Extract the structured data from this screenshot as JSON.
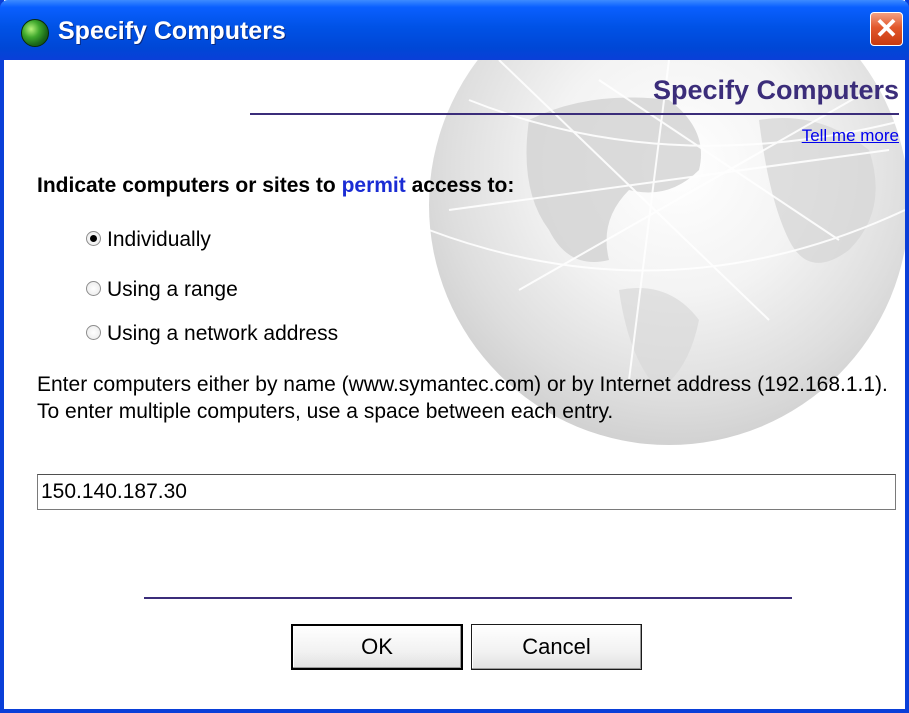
{
  "window": {
    "title": "Specify Computers",
    "icon": "globe-icon",
    "close_glyph": "✕"
  },
  "header": {
    "title": "Specify Computers",
    "help_link": "Tell me more"
  },
  "prompt": {
    "prefix": "Indicate computers or sites to ",
    "emphasis": "permit",
    "suffix": " access to:"
  },
  "options": [
    {
      "label": "Individually",
      "checked": true
    },
    {
      "label": "Using a range",
      "checked": false
    },
    {
      "label": "Using a network address",
      "checked": false
    }
  ],
  "instructions": "Enter computers either by name (www.symantec.com) or by Internet address (192.168.1.1). To enter multiple computers, use a space between each entry.",
  "entry": {
    "value": "150.140.187.30"
  },
  "buttons": {
    "ok": "OK",
    "cancel": "Cancel"
  },
  "colors": {
    "titlebar": "#0052e6",
    "accent": "#3b2d7a",
    "permit": "#1a2cd4",
    "link": "#0000ee"
  }
}
